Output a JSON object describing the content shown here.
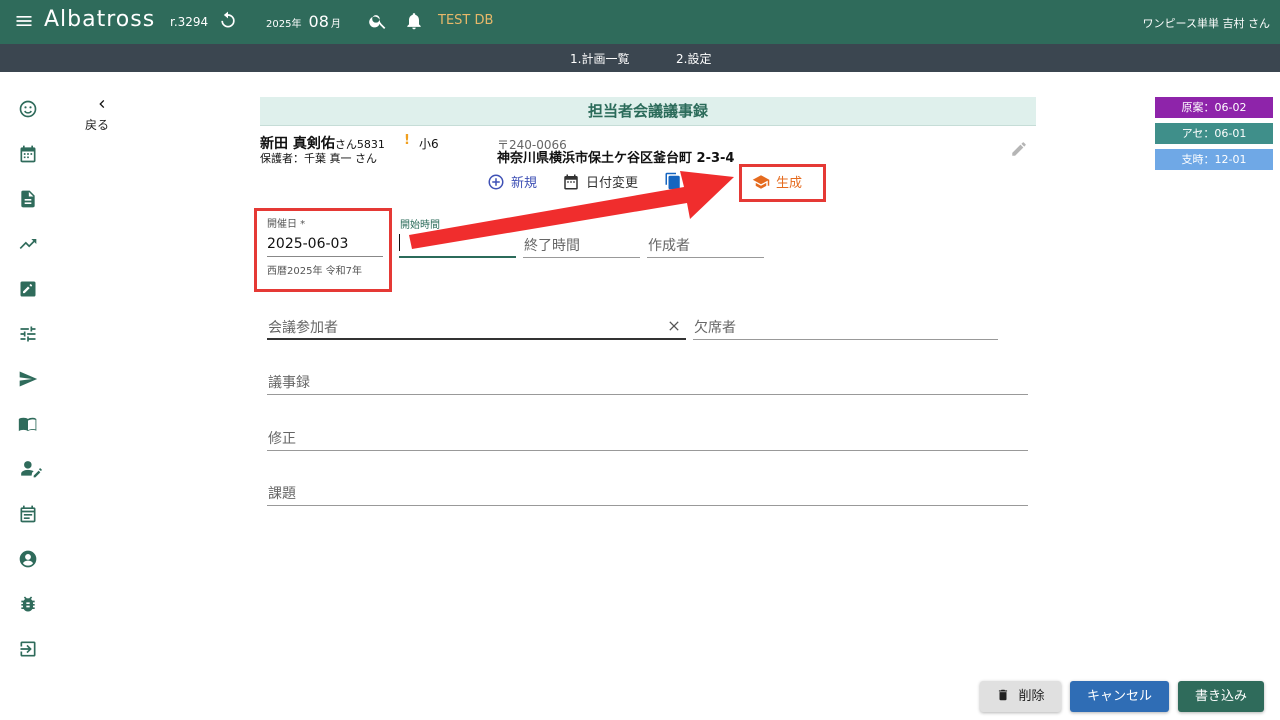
{
  "topbar": {
    "app_name": "Albatross",
    "revision": "r.3294",
    "year": "2025",
    "year_unit": "年",
    "month": "08",
    "month_unit": "月",
    "db_name": "TEST DB",
    "user": "ワンピース単単 吉村 さん"
  },
  "subnav": {
    "items": [
      {
        "label": "1.計画一覧"
      },
      {
        "label": "2.設定"
      }
    ]
  },
  "sidebar": {
    "icons": [
      "face-icon",
      "calendar-icon",
      "document-icon",
      "trend-icon",
      "edit-note-icon",
      "tune-icon",
      "send-icon",
      "book-icon",
      "person-edit-icon",
      "event-icon",
      "account-circle-icon",
      "bug-icon",
      "logout-icon"
    ]
  },
  "back": {
    "label": "戻る"
  },
  "page": {
    "title": "担当者会議議事録"
  },
  "patient": {
    "name": "新田 真剣佑",
    "honorific": "さん",
    "id": "5831",
    "warning": "!",
    "grade": "小6",
    "guardian": "保護者：千葉 真一 さん",
    "postal": "〒240-0066",
    "address": "神奈川県横浜市保土ケ谷区釜台町 2-3-4"
  },
  "actions": {
    "new": "新規",
    "change_date": "日付変更",
    "generate": "生成"
  },
  "status": {
    "chips": [
      {
        "label": "原案：06-02",
        "color": "#8e24aa"
      },
      {
        "label": "アセ：06-01",
        "color": "#3f8f8a"
      },
      {
        "label": "支時：12-01",
        "color": "#6fa8e6"
      }
    ]
  },
  "form": {
    "date_label": "開催日 *",
    "date_value": "2025-06-03",
    "date_hint": "西暦2025年 令和7年",
    "start_time_label": "開始時間",
    "end_time_placeholder": "終了時間",
    "author_placeholder": "作成者",
    "participants_placeholder": "会議参加者",
    "absentees_placeholder": "欠席者",
    "minutes_placeholder": "議事録",
    "revision_placeholder": "修正",
    "issues_placeholder": "課題"
  },
  "buttons": {
    "delete": "削除",
    "cancel": "キャンセル",
    "save": "書き込み"
  },
  "colors": {
    "primary": "#2f6b5b",
    "subnav": "#3b4650",
    "annotation": "#e53935",
    "generate": "#e56b1f"
  }
}
